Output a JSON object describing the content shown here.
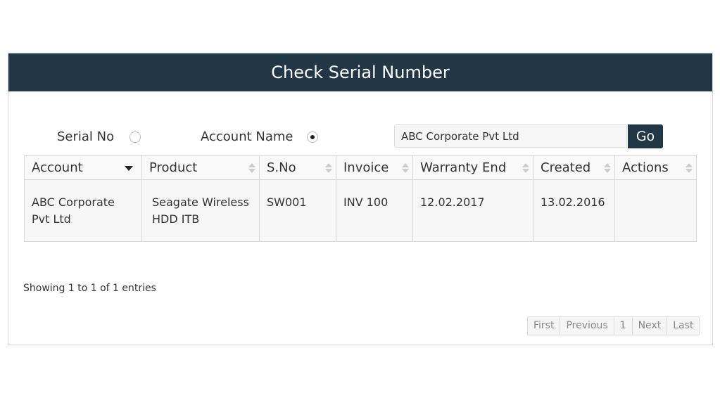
{
  "title": "Check Serial Number",
  "filter": {
    "serial_label": "Serial No",
    "serial_selected": false,
    "account_label": "Account Name",
    "account_selected": true,
    "search_value": "ABC Corporate Pvt Ltd",
    "go_label": "Go"
  },
  "table": {
    "columns": [
      "Account",
      "Product",
      "S.No",
      "Invoice",
      "Warranty End",
      "Created",
      "Actions"
    ],
    "sorted_column": "Account",
    "sort_direction": "descending",
    "rows": [
      {
        "account": "ABC Corporate Pvt Ltd",
        "product": "Seagate Wireless HDD ITB",
        "sno": "SW001",
        "invoice": "INV 100",
        "warranty_end": "12.02.2017",
        "created": "13.02.2016",
        "actions": ""
      }
    ]
  },
  "info": "Showing 1 to 1 of 1 entries",
  "pagination": [
    "First",
    "Previous",
    "1",
    "Next",
    "Last"
  ],
  "colors": {
    "header": "#223746"
  }
}
